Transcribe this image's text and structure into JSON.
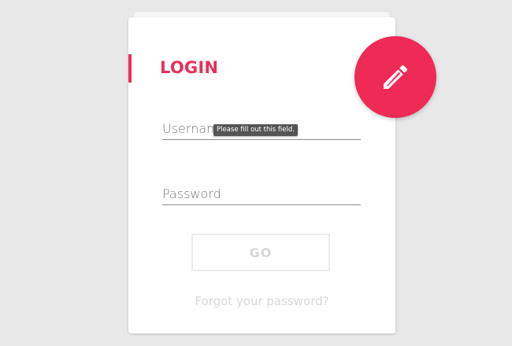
{
  "login": {
    "title": "LOGIN",
    "username_placeholder": "Username",
    "password_placeholder": "Password",
    "validation_tooltip": "Please fill out this field.",
    "go_label": "GO",
    "forgot_label": "Forgot your password?"
  },
  "fab": {
    "icon": "pencil-icon"
  },
  "colors": {
    "accent": "#e8305a",
    "fab": "#ef2a56",
    "background": "#e8e8e8",
    "card": "#ffffff"
  }
}
